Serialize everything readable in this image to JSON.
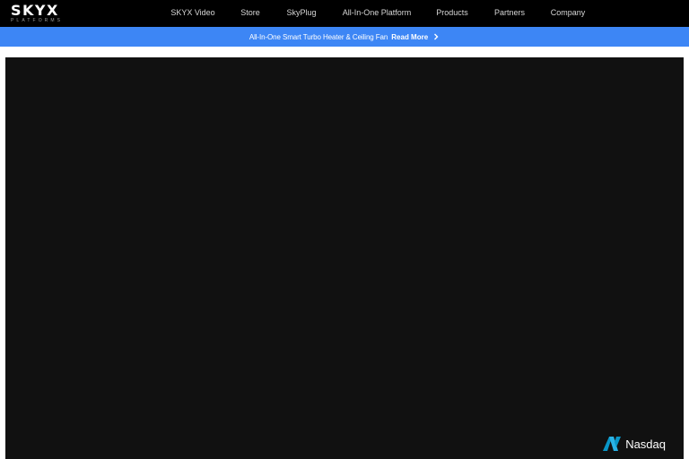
{
  "header": {
    "logo": {
      "name": "SKYX",
      "tagline": "PLATFORMS"
    },
    "nav": [
      {
        "label": "SKYX Video"
      },
      {
        "label": "Store"
      },
      {
        "label": "SkyPlug"
      },
      {
        "label": "All-In-One Platform"
      },
      {
        "label": "Products"
      },
      {
        "label": "Partners"
      },
      {
        "label": "Company"
      }
    ]
  },
  "banner": {
    "text": "All-In-One Smart Turbo Heater & Ceiling Fan",
    "link_label": "Read More",
    "icon": "chevron-right-icon",
    "background_color": "#3d86f5"
  },
  "video": {
    "background_color": "#111111",
    "brand": {
      "label": "Nasdaq",
      "icon": "nasdaq-logo-icon",
      "accent_color": "#0996c7"
    }
  }
}
